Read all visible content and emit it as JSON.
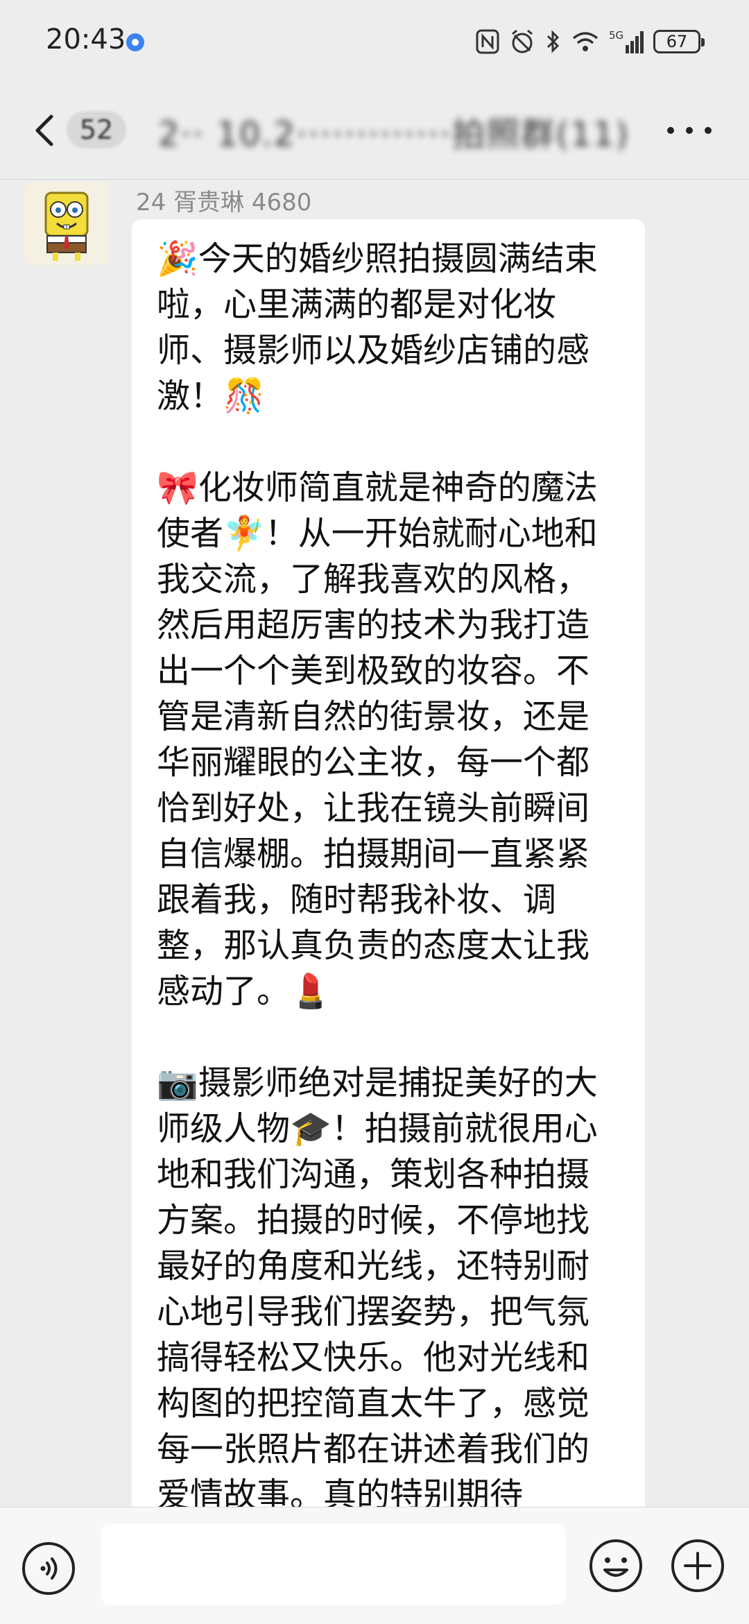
{
  "status_bar": {
    "time": "20:43",
    "network": "5G",
    "battery": "67"
  },
  "header": {
    "unread_count": "52",
    "title": "2·· 10.2·············拍照群(11)"
  },
  "message": {
    "sender": "24 胥贵琳 4680",
    "paragraphs": [
      "🎉今天的婚纱照拍摄圆满结束啦，心里满满的都是对化妆师、摄影师以及婚纱店铺的感激！🎊",
      "🎀化妆师简直就是神奇的魔法使者🧚！从一开始就耐心地和我交流，了解我喜欢的风格，然后用超厉害的技术为我打造出一个个美到极致的妆容。不管是清新自然的街景妆，还是华丽耀眼的公主妆，每一个都恰到好处，让我在镜头前瞬间自信爆棚。拍摄期间一直紧紧跟着我，随时帮我补妆、调整，那认真负责的态度太让我感动了。💄",
      "📷摄影师绝对是捕捉美好的大师级人物🎓！拍摄前就很用心地和我们沟通，策划各种拍摄方案。拍摄的时候，不停地找最好的角度和光线，还特别耐心地引导我们摆姿势，把气氛搞得轻松又快乐。他对光线和构图的把控简直太牛了，感觉每一张照片都在讲述着我们的爱情故事。真的特别期待"
    ]
  },
  "input": {
    "value": "",
    "placeholder": ""
  }
}
